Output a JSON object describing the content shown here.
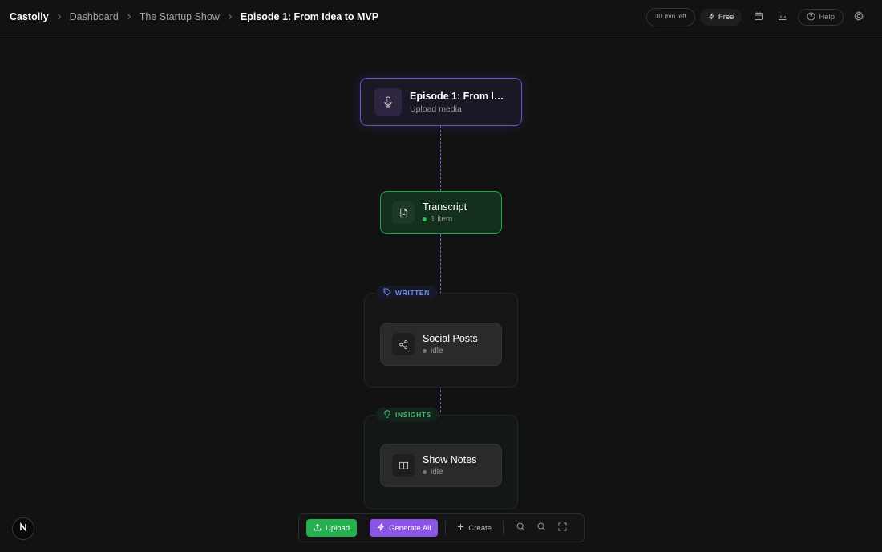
{
  "header": {
    "brand": "Castolly",
    "breadcrumbs": [
      "Dashboard",
      "The Startup Show"
    ],
    "current": "Episode 1: From Idea to MVP",
    "time_left": "30 min left",
    "plan": "Free",
    "help": "Help"
  },
  "nodes": {
    "episode": {
      "title": "Episode 1: From Idea to MVP",
      "subtitle": "Upload media"
    },
    "transcript": {
      "title": "Transcript",
      "status": "1 item"
    },
    "groups": {
      "written": {
        "label": "WRITTEN"
      },
      "insights": {
        "label": "INSIGHTS"
      }
    },
    "social": {
      "title": "Social Posts",
      "status": "idle"
    },
    "notes": {
      "title": "Show Notes",
      "status": "idle"
    }
  },
  "toolbar": {
    "upload": "Upload",
    "generate_all": "Generate All",
    "create": "Create"
  },
  "colors": {
    "accent_purple": "#8a55e6",
    "accent_green": "#22b14e",
    "written_tag": "#6d8ff0",
    "insights_tag": "#3fb873"
  },
  "icons": {
    "episode": "microphone-icon",
    "transcript": "document-icon",
    "social": "share-icon",
    "notes": "book-icon"
  }
}
